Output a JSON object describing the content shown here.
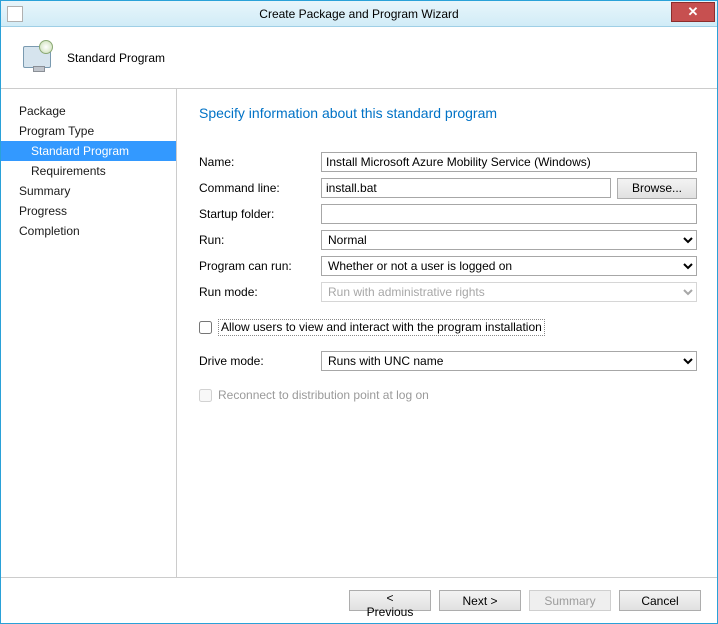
{
  "window": {
    "title": "Create Package and Program Wizard"
  },
  "header": {
    "title": "Standard Program"
  },
  "nav": {
    "items": [
      {
        "label": "Package",
        "selected": false,
        "indent": 0
      },
      {
        "label": "Program Type",
        "selected": false,
        "indent": 0
      },
      {
        "label": "Standard Program",
        "selected": true,
        "indent": 1
      },
      {
        "label": "Requirements",
        "selected": false,
        "indent": 1
      },
      {
        "label": "Summary",
        "selected": false,
        "indent": 0
      },
      {
        "label": "Progress",
        "selected": false,
        "indent": 0
      },
      {
        "label": "Completion",
        "selected": false,
        "indent": 0
      }
    ]
  },
  "content": {
    "title": "Specify information about this standard program",
    "labels": {
      "name": "Name:",
      "command_line": "Command line:",
      "browse": "Browse...",
      "startup_folder": "Startup folder:",
      "run": "Run:",
      "program_can_run": "Program can run:",
      "run_mode": "Run mode:",
      "allow_interact": "Allow users to view and interact with the program installation",
      "drive_mode": "Drive mode:",
      "reconnect": "Reconnect to distribution point at log on"
    },
    "values": {
      "name": "Install Microsoft Azure Mobility Service (Windows)",
      "command_line": "install.bat",
      "startup_folder": "",
      "run": "Normal",
      "program_can_run": "Whether or not a user is logged on",
      "run_mode": "Run with administrative rights",
      "allow_interact": false,
      "drive_mode": "Runs with UNC name",
      "reconnect": false
    }
  },
  "footer": {
    "previous": "< Previous",
    "next": "Next >",
    "summary": "Summary",
    "cancel": "Cancel"
  }
}
